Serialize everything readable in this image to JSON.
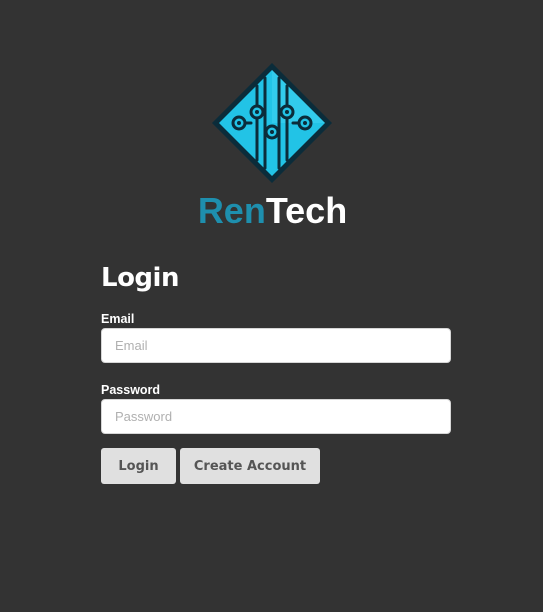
{
  "brand": {
    "name_part1": "Ren",
    "name_part2": "Tech",
    "colors": {
      "accent": "#1e8fae",
      "logo_fill": "#22c3e6",
      "logo_dark": "#0b2c3a",
      "background": "#333333"
    },
    "logo_icon": "circuit-diamond-icon"
  },
  "form": {
    "title": "Login",
    "email_label": "Email",
    "email_placeholder": "Email",
    "email_value": "",
    "password_label": "Password",
    "password_placeholder": "Password",
    "password_value": "",
    "login_button": "Login",
    "create_account_button": "Create Account"
  }
}
